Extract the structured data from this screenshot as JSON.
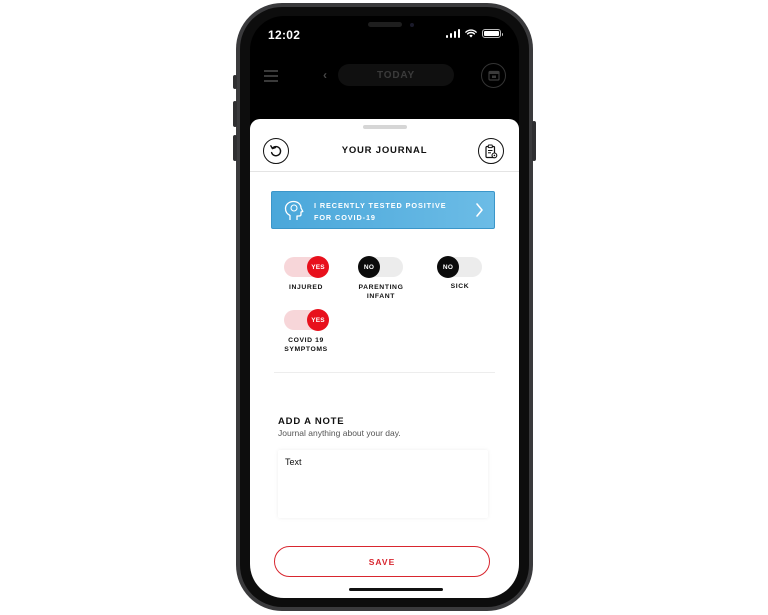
{
  "status_bar": {
    "time": "12:02"
  },
  "app_header": {
    "date_label": "TODAY"
  },
  "journal": {
    "title": "YOUR JOURNAL",
    "banner": {
      "line1": "I RECENTLY TESTED POSITIVE",
      "line2": "FOR COVID-19"
    },
    "toggles": [
      {
        "label_line1": "INJURED",
        "label_line2": "",
        "state": "YES"
      },
      {
        "label_line1": "PARENTING",
        "label_line2": "INFANT",
        "state": "NO"
      },
      {
        "label_line1": "SICK",
        "label_line2": "",
        "state": "NO"
      },
      {
        "label_line1": "COVID 19",
        "label_line2": "SYMPTOMS",
        "state": "YES"
      }
    ],
    "note": {
      "title": "ADD A NOTE",
      "subtitle": "Journal anything about your day.",
      "value": "Text"
    },
    "save_label": "SAVE"
  },
  "colors": {
    "accent_red": "#e8101c",
    "banner_blue": "#4aa7da",
    "toggle_no": "#0b0b0b"
  },
  "icons": {
    "menu": "hamburger-icon",
    "back": "chevron-left-icon",
    "calendar": "calendar-icon",
    "undo": "undo-icon",
    "settings": "clipboard-settings-icon",
    "banner": "head-profile-icon",
    "banner_arrow": "chevron-right-icon"
  }
}
